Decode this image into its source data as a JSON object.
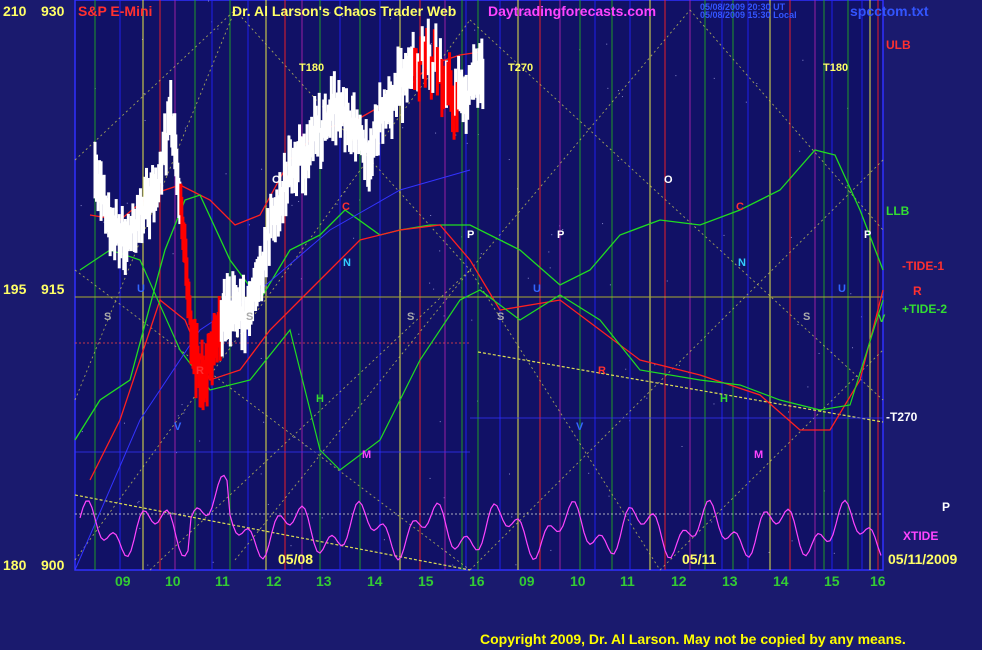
{
  "header": {
    "left_title": "S&P E-Mini",
    "main_title": "Dr. Al Larson's Chaos Trader Web",
    "site": "Daytradingforecasts.com",
    "timestamp_ut": "05/08/2009 20:30 UT",
    "timestamp_local": "05/08/2009 15:30 Local",
    "file": "spcctom.txt"
  },
  "copyright": "Copyright 2009, Dr. Al Larson. May not be copied by any means.",
  "colors": {
    "background": "#1a1a6e",
    "price_up": "#ffffff",
    "price_down": "#ff0000",
    "ulb": "#ff2020",
    "llb": "#20dd20",
    "tide1": "#ff2020",
    "tide2": "#20dd20",
    "t270": "#2020ff",
    "xtide": "#ff44ff",
    "title_yellow": "#ffff66",
    "copyright": "#ffff00"
  },
  "chart_data": {
    "type": "line",
    "title": "S&P E-Mini",
    "y_axis_left_outer": [
      "210",
      "195",
      "180"
    ],
    "y_axis_left_inner": [
      "930",
      "915",
      "900"
    ],
    "ylim": [
      900,
      930
    ],
    "x_tick_labels": [
      "09",
      "10",
      "11",
      "12",
      "13",
      "14",
      "15",
      "16",
      "09",
      "10",
      "11",
      "12",
      "13",
      "14",
      "15",
      "16"
    ],
    "date_labels": [
      "05/08",
      "05/11",
      "05/11/2009"
    ],
    "series_labels": [
      "ULB",
      "LLB",
      "-TIDE-1",
      "+TIDE-2",
      "-T270",
      "XTIDE",
      "R",
      "P"
    ],
    "markers": {
      "T180": "T180",
      "T270": "T270",
      "O": "O",
      "N": "N",
      "P": "P",
      "S": "S",
      "H": "H",
      "M": "M",
      "C": "C",
      "R": "R",
      "U": "U",
      "V": "V"
    },
    "price_bars_approx": [
      {
        "x": 8.3,
        "close": 920.5
      },
      {
        "x": 8.6,
        "close": 918.2
      },
      {
        "x": 8.9,
        "close": 917.0
      },
      {
        "x": 9.2,
        "close": 918.8
      },
      {
        "x": 9.5,
        "close": 919.7
      },
      {
        "x": 9.8,
        "close": 924.0
      },
      {
        "x": 10.0,
        "close": 919.0
      },
      {
        "x": 10.2,
        "close": 912.4
      },
      {
        "x": 10.4,
        "close": 910.0
      },
      {
        "x": 10.6,
        "close": 911.4
      },
      {
        "x": 10.8,
        "close": 912.8
      },
      {
        "x": 11.0,
        "close": 914.0
      },
      {
        "x": 11.3,
        "close": 913.6
      },
      {
        "x": 11.6,
        "close": 915.8
      },
      {
        "x": 11.9,
        "close": 919.2
      },
      {
        "x": 12.2,
        "close": 921.1
      },
      {
        "x": 12.5,
        "close": 922.0
      },
      {
        "x": 12.8,
        "close": 923.4
      },
      {
        "x": 13.1,
        "close": 924.2
      },
      {
        "x": 13.4,
        "close": 923.0
      },
      {
        "x": 13.7,
        "close": 922.0
      },
      {
        "x": 14.0,
        "close": 924.0
      },
      {
        "x": 14.3,
        "close": 925.3
      },
      {
        "x": 14.6,
        "close": 926.2
      },
      {
        "x": 14.9,
        "close": 927.4
      },
      {
        "x": 15.2,
        "close": 925.5
      },
      {
        "x": 15.5,
        "close": 924.7
      },
      {
        "x": 15.8,
        "close": 925.5
      },
      {
        "x": 16.0,
        "close": 926.6
      }
    ]
  }
}
